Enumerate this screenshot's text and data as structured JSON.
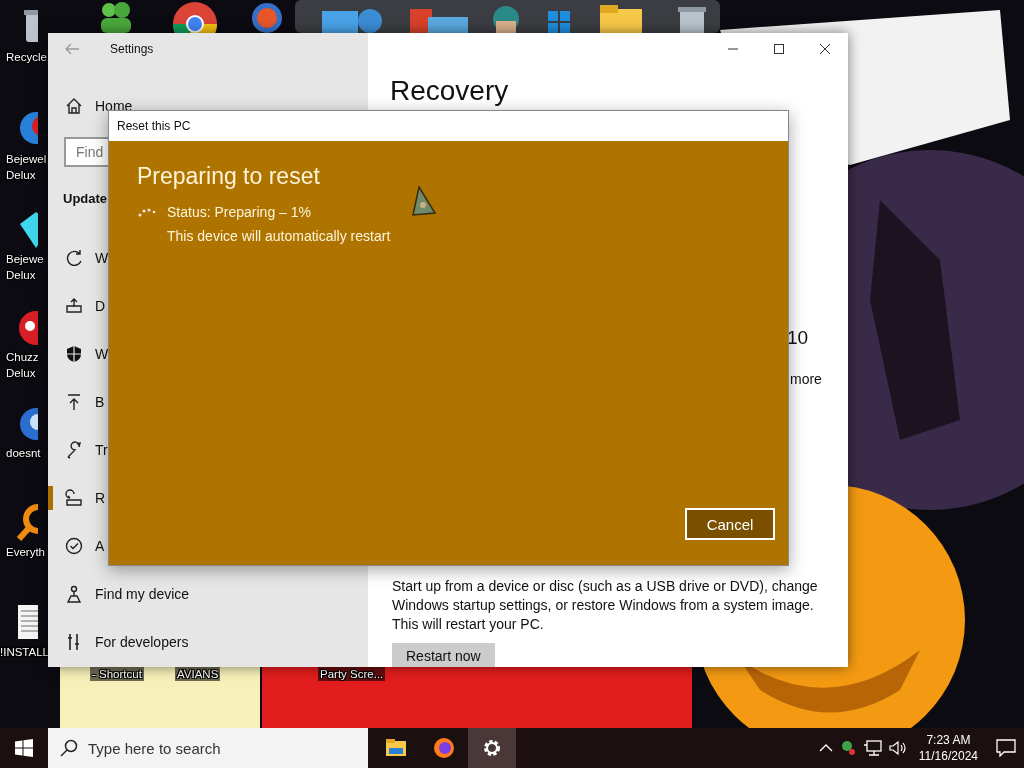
{
  "desktop": {
    "icons": [
      {
        "lines": [
          "Recycle"
        ]
      },
      {
        "lines": [
          "Bejewel",
          "Delux"
        ]
      },
      {
        "lines": [
          "Bejewe",
          "Delux"
        ]
      },
      {
        "lines": [
          "Chuzz",
          "Delux"
        ]
      },
      {
        "lines": [
          "doesnt"
        ]
      },
      {
        "lines": [
          "Everyth"
        ]
      },
      {
        "lines": [
          "!INSTALL"
        ]
      },
      {
        "lines": [
          "- Shortcut"
        ]
      },
      {
        "lines": [
          "AVIANS"
        ]
      },
      {
        "lines": [
          "Party Scre..."
        ]
      }
    ]
  },
  "settings_window": {
    "title": "Settings",
    "home": "Home",
    "search": {
      "placeholder": "Find"
    },
    "section": "Update",
    "nav": [
      {
        "label": "W",
        "selected": false
      },
      {
        "label": "D",
        "selected": false
      },
      {
        "label": "W",
        "selected": false
      },
      {
        "label": "B",
        "selected": false
      },
      {
        "label": "Tr",
        "selected": false
      },
      {
        "label": "R",
        "selected": true
      },
      {
        "label": "A",
        "selected": false
      },
      {
        "label": "Find my device",
        "selected": false
      },
      {
        "label": "For developers",
        "selected": false
      }
    ],
    "page_title": "Recovery",
    "fragments": [
      "10",
      "more"
    ],
    "paragraph": "Start up from a device or disc (such as a USB drive or DVD), change Windows startup settings, or restore Windows from a system image. This will restart your PC.",
    "button": "Restart now"
  },
  "dialog": {
    "title": "Reset this PC",
    "heading": "Preparing to reset",
    "status": "Status: Preparing – 1%",
    "note": "This device will automatically restart",
    "cancel": "Cancel"
  },
  "taskbar": {
    "search": {
      "placeholder": "Type here to search"
    },
    "apps": [
      {
        "selected": false
      },
      {
        "selected": false
      },
      {
        "selected": true
      }
    ],
    "time": "7:23 AM",
    "date": "11/16/2024"
  }
}
